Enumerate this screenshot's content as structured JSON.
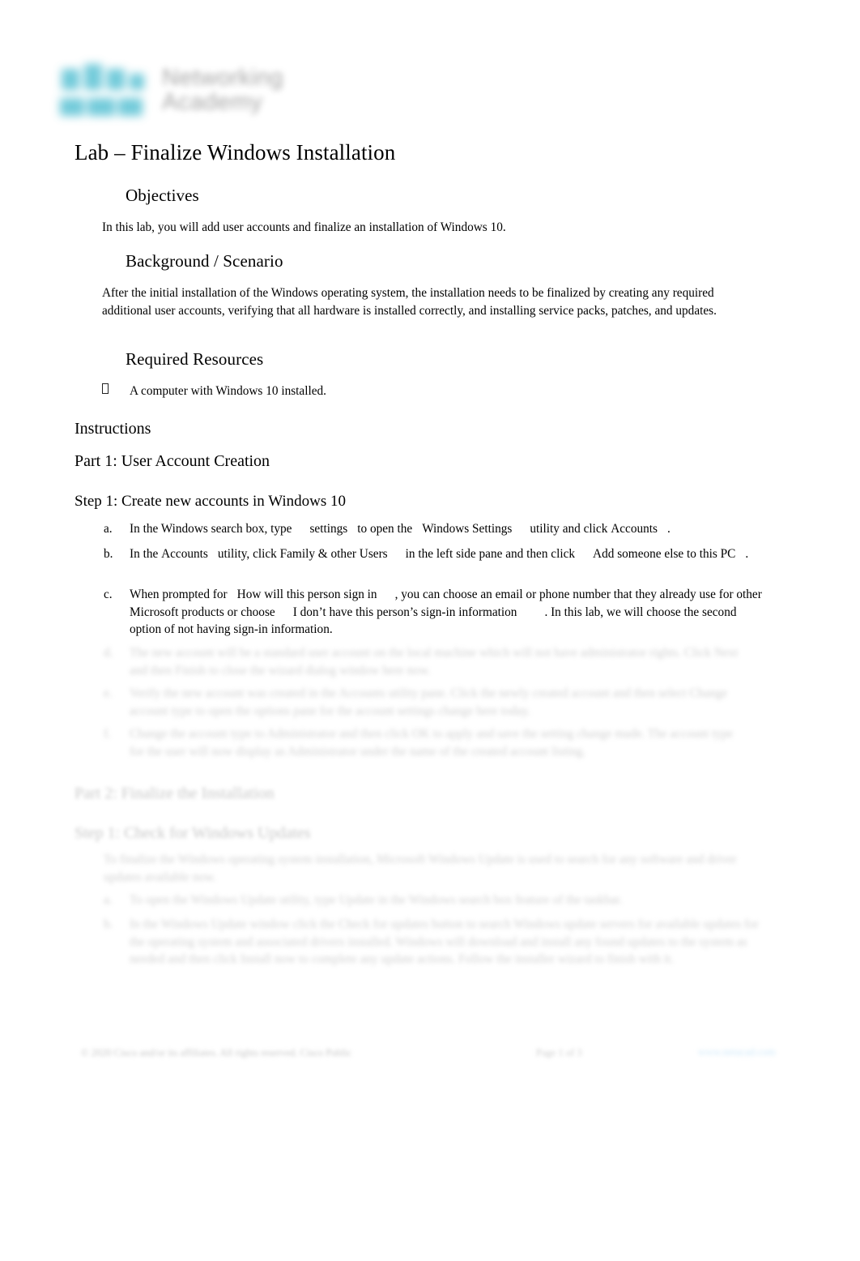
{
  "logo": {
    "name": "cisco-networking-academy-logo",
    "line1": "Networking",
    "line2": "Academy",
    "mark_color": "#5bc2d4",
    "text_color": "#5a5a5a"
  },
  "document": {
    "title": "Lab – Finalize Windows Installation",
    "sections": {
      "objectives": {
        "heading": "Objectives",
        "paragraph": "In this lab, you will add user accounts and finalize an installation of Windows 10."
      },
      "background": {
        "heading": "Background / Scenario",
        "paragraph": "After the initial installation of the Windows operating system, the installation needs to be finalized by creating any required additional user accounts, verifying that all hardware is installed correctly, and installing service packs, patches, and updates."
      },
      "required_resources": {
        "heading": "Required Resources",
        "bullet_glyph": "□",
        "items": [
          "A computer with Windows 10 installed."
        ]
      },
      "instructions": {
        "heading": "Instructions"
      },
      "part1": {
        "heading": "Part 1: User Account Creation",
        "step1": {
          "heading": "Step 1: Create new accounts in Windows 10",
          "items": [
            {
              "marker": "a.",
              "runs": [
                {
                  "text": "In the Windows search box, type",
                  "bold": false
                },
                {
                  "text": "settings",
                  "bold": true
                },
                {
                  "text": "to open the",
                  "bold": false
                },
                {
                  "text": "Windows Settings",
                  "bold": true
                },
                {
                  "text": "utility and click",
                  "bold": false
                },
                {
                  "text": "Accounts",
                  "bold": true
                },
                {
                  "text": ".",
                  "bold": false
                }
              ]
            },
            {
              "marker": "b.",
              "runs": [
                {
                  "text": "In the",
                  "bold": false
                },
                {
                  "text": "Accounts",
                  "bold": true
                },
                {
                  "text": "utility, click Family & other Users",
                  "bold": false
                },
                {
                  "text": "in the left side pane and then click",
                  "bold": false
                },
                {
                  "text": "Add someone else to this PC",
                  "bold": true
                },
                {
                  "text": ".",
                  "bold": false
                }
              ]
            },
            {
              "marker": "c.",
              "runs": [
                {
                  "text": "When prompted for",
                  "bold": false
                },
                {
                  "text": "How will this person sign in",
                  "bold": true
                },
                {
                  "text": ", you can choose an email or phone number that they already use for other Microsoft products or choose",
                  "bold": false
                },
                {
                  "text": "I don’t have this person’s sign-in information",
                  "bold": true
                },
                {
                  "text": ". In this lab, we will choose the second option of not having sign-in information.",
                  "bold": false
                }
              ]
            }
          ]
        }
      }
    },
    "redacted": {
      "note": "illegible-blurred-content",
      "blocks": [
        {
          "marker": "d.",
          "lines": 2
        },
        {
          "marker": "e.",
          "lines": 2
        },
        {
          "marker": "f.",
          "lines": 3
        }
      ],
      "headings": [
        "part2-heading",
        "part2-step1-heading"
      ],
      "blocks2": [
        {
          "marker": "",
          "lines": 2
        },
        {
          "marker": "a.",
          "lines": 1
        },
        {
          "marker": "b.",
          "lines": 4
        }
      ]
    },
    "footer": {
      "left": "illegible",
      "center": "illegible",
      "right": "illegible",
      "right_color": "#cbe7f8"
    }
  }
}
